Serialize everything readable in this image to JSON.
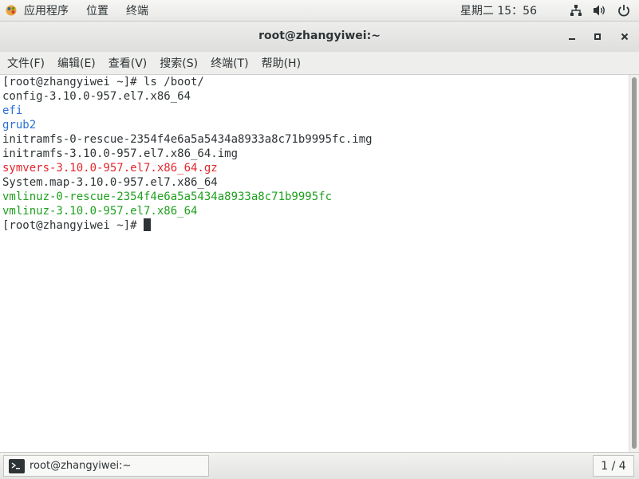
{
  "top_panel": {
    "applications": "应用程序",
    "places": "位置",
    "terminal": "终端",
    "clock": "星期二 15：56",
    "tray_icons": [
      "network-icon",
      "volume-icon",
      "power-icon"
    ]
  },
  "window": {
    "title": "root@zhangyiwei:~",
    "controls": {
      "minimize": "_",
      "maximize": "▫",
      "close": "×"
    },
    "menu": [
      "文件(F)",
      "编辑(E)",
      "查看(V)",
      "搜索(S)",
      "终端(T)",
      "帮助(H)"
    ]
  },
  "terminal": {
    "lines": [
      {
        "text": "[root@zhangyiwei ~]# ls /boot/",
        "color": "default"
      },
      {
        "text": "config-3.10.0-957.el7.x86_64",
        "color": "default"
      },
      {
        "text": "efi",
        "color": "blue"
      },
      {
        "text": "grub2",
        "color": "blue"
      },
      {
        "text": "initramfs-0-rescue-2354f4e6a5a5434a8933a8c71b9995fc.img",
        "color": "default"
      },
      {
        "text": "initramfs-3.10.0-957.el7.x86_64.img",
        "color": "default"
      },
      {
        "text": "symvers-3.10.0-957.el7.x86_64.gz",
        "color": "red"
      },
      {
        "text": "System.map-3.10.0-957.el7.x86_64",
        "color": "default"
      },
      {
        "text": "vmlinuz-0-rescue-2354f4e6a5a5434a8933a8c71b9995fc",
        "color": "green"
      },
      {
        "text": "vmlinuz-3.10.0-957.el7.x86_64",
        "color": "green"
      }
    ],
    "prompt": "[root@zhangyiwei ~]# ",
    "colors": {
      "default": "#2e3436",
      "blue": "#2a6fd6",
      "red": "#e0272c",
      "green": "#1fa01f"
    }
  },
  "taskbar": {
    "task_label": "root@zhangyiwei:~",
    "workspace": "1 / 4"
  }
}
